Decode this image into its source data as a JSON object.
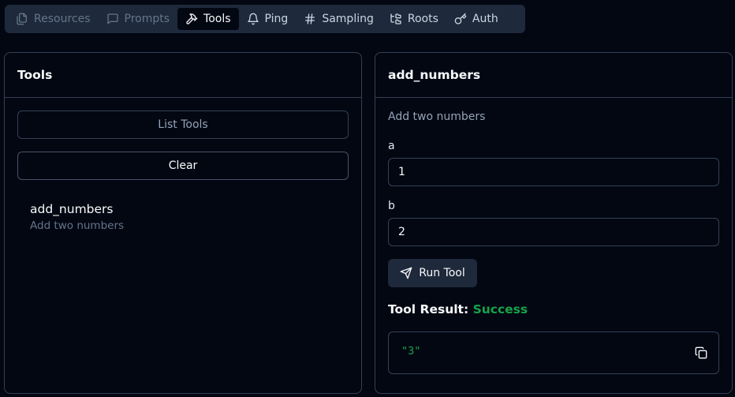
{
  "tabs": [
    {
      "label": "Resources",
      "icon": "files-icon",
      "state": "disabled"
    },
    {
      "label": "Prompts",
      "icon": "message-square-icon",
      "state": "disabled"
    },
    {
      "label": "Tools",
      "icon": "hammer-icon",
      "state": "active"
    },
    {
      "label": "Ping",
      "icon": "bell-icon",
      "state": "normal"
    },
    {
      "label": "Sampling",
      "icon": "hash-icon",
      "state": "normal"
    },
    {
      "label": "Roots",
      "icon": "folder-tree-icon",
      "state": "normal"
    },
    {
      "label": "Auth",
      "icon": "key-icon",
      "state": "normal"
    }
  ],
  "tools_panel": {
    "title": "Tools",
    "list_button": "List Tools",
    "clear_button": "Clear",
    "tools": [
      {
        "name": "add_numbers",
        "description": "Add two numbers"
      }
    ]
  },
  "detail_panel": {
    "title": "add_numbers",
    "description": "Add two numbers",
    "fields": [
      {
        "label": "a",
        "value": "1"
      },
      {
        "label": "b",
        "value": "2"
      }
    ],
    "run_button": "Run Tool",
    "result_label": "Tool Result:",
    "result_status": "Success",
    "result_value": "\"3\""
  },
  "colors": {
    "background": "#030712",
    "border": "#334155",
    "muted": "#1e293b",
    "success": "#16a34a"
  }
}
